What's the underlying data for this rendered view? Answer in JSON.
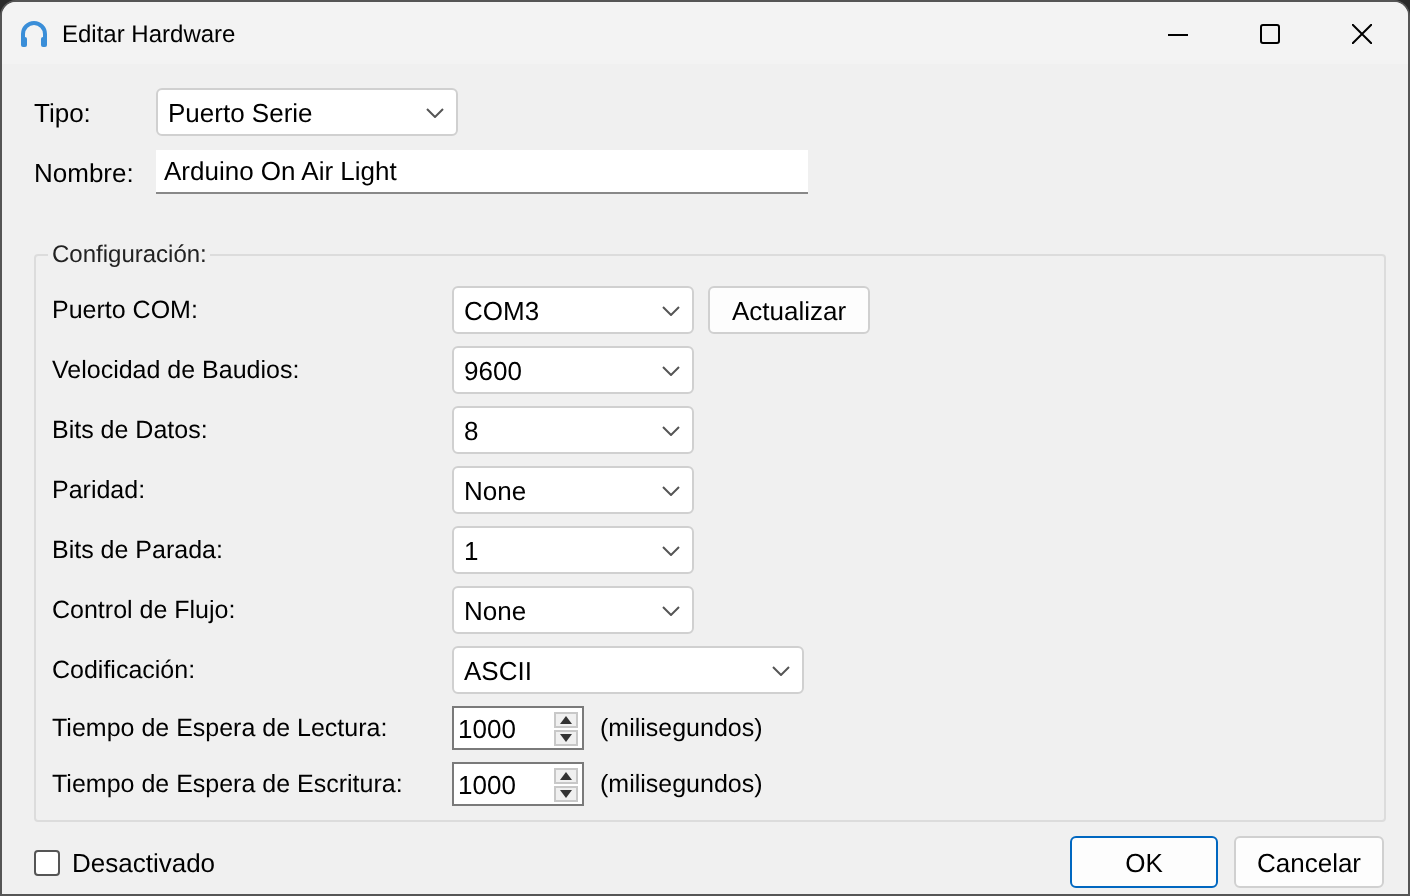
{
  "window": {
    "title": "Editar Hardware"
  },
  "tipo": {
    "label": "Tipo:",
    "value": "Puerto Serie"
  },
  "nombre": {
    "label": "Nombre:",
    "value": "Arduino On Air Light"
  },
  "configuracion": {
    "title": "Configuración:",
    "rows": [
      {
        "kind": "select",
        "label": "Puerto COM:",
        "value": "COM3",
        "button": "Actualizar"
      },
      {
        "kind": "select",
        "label": "Velocidad de Baudios:",
        "value": "9600"
      },
      {
        "kind": "select",
        "label": "Bits de Datos:",
        "value": "8"
      },
      {
        "kind": "select",
        "label": "Paridad:",
        "value": "None"
      },
      {
        "kind": "select",
        "label": "Bits de Parada:",
        "value": "1"
      },
      {
        "kind": "select",
        "label": "Control de Flujo:",
        "value": "None"
      },
      {
        "kind": "wide_select",
        "label": "Codificación:",
        "value": "ASCII"
      },
      {
        "kind": "spin",
        "label": "Tiempo de Espera de Lectura:",
        "value": "1000",
        "unit": "(milisegundos)"
      },
      {
        "kind": "spin",
        "label": "Tiempo de Espera de Escritura:",
        "value": "1000",
        "unit": "(milisegundos)"
      }
    ]
  },
  "disabled_checkbox": {
    "label": "Desactivado",
    "checked": false
  },
  "buttons": [
    {
      "label": "OK",
      "default": true
    },
    {
      "label": "Cancelar",
      "default": false
    }
  ]
}
